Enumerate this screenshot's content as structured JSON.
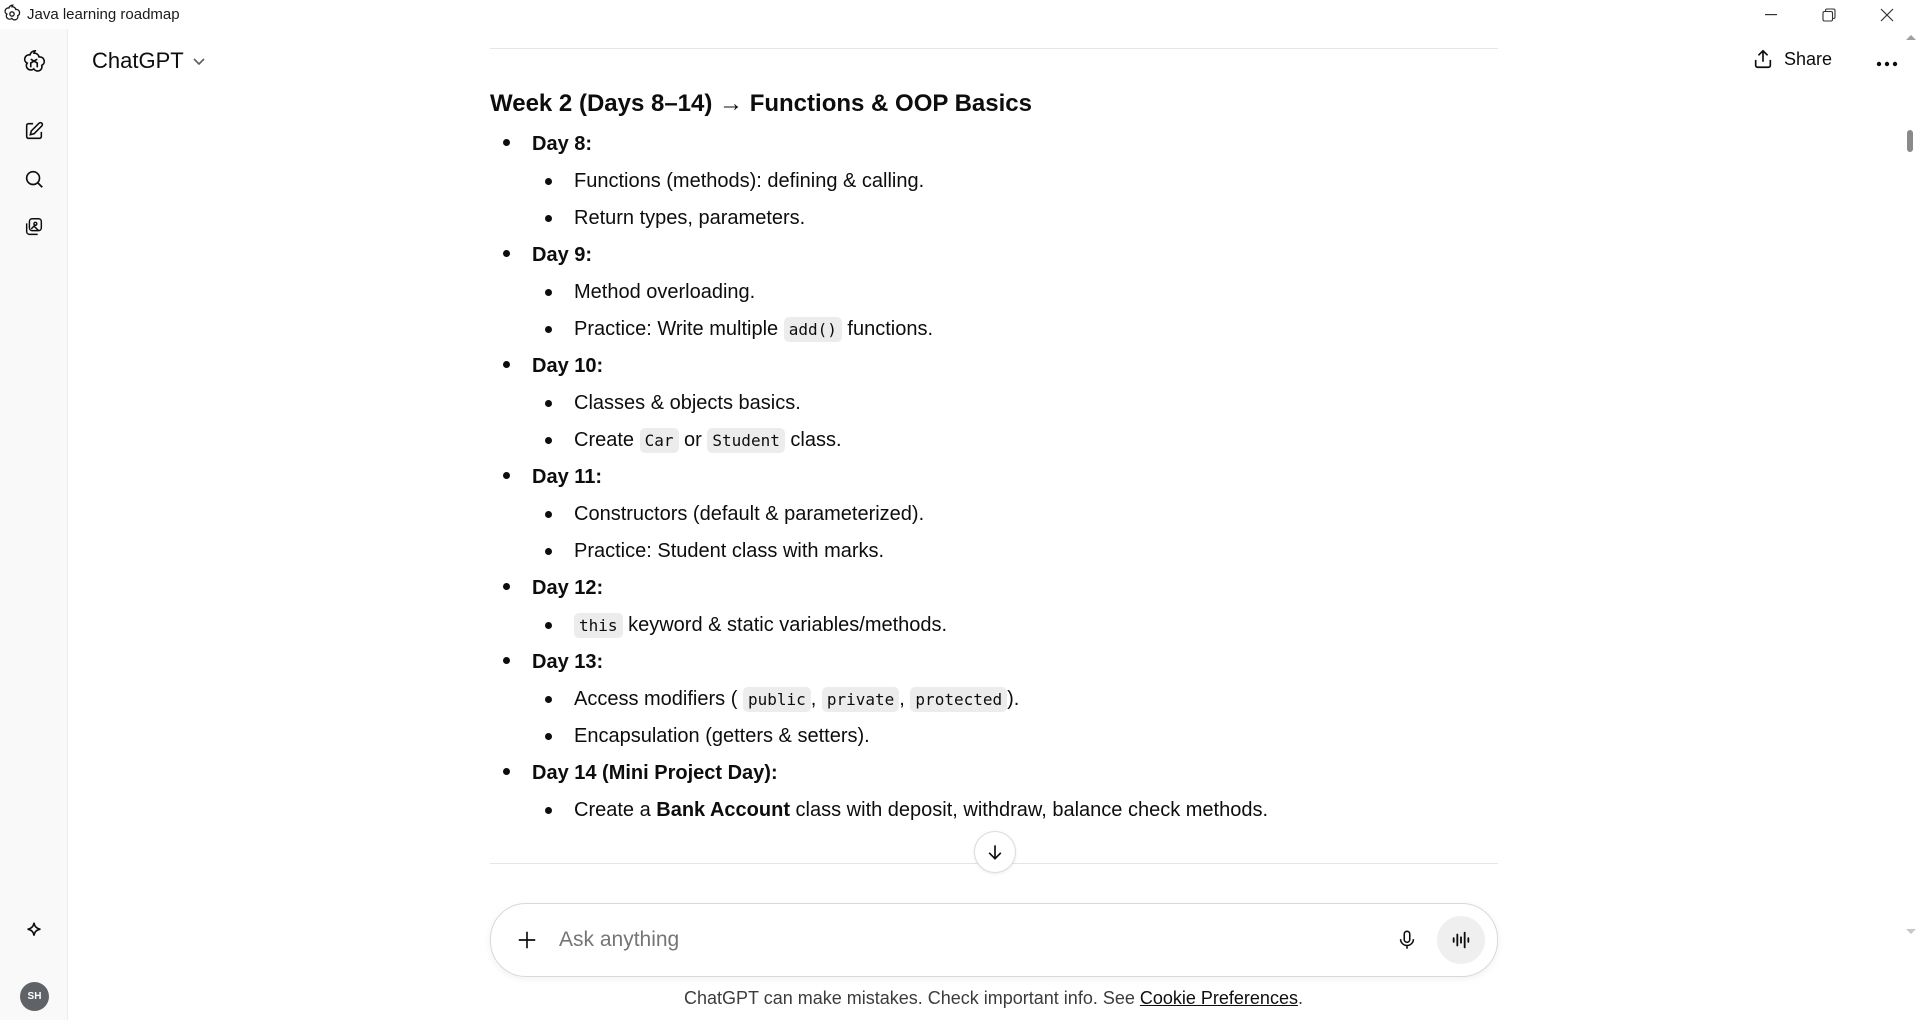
{
  "window": {
    "title": "Java learning roadmap"
  },
  "header": {
    "model_label": "ChatGPT",
    "share_label": "Share"
  },
  "sidebar": {
    "avatar_initials": "SH"
  },
  "content": {
    "week_heading": "Week 2 (Days 8–14) → Functions & OOP Basics",
    "days": [
      {
        "title": "Day 8:",
        "items": [
          [
            {
              "t": "Functions (methods): defining & calling."
            }
          ],
          [
            {
              "t": "Return types, parameters."
            }
          ]
        ]
      },
      {
        "title": "Day 9:",
        "items": [
          [
            {
              "t": "Method overloading."
            }
          ],
          [
            {
              "t": "Practice: Write multiple "
            },
            {
              "c": "add()"
            },
            {
              "t": " functions."
            }
          ]
        ]
      },
      {
        "title": "Day 10:",
        "items": [
          [
            {
              "t": "Classes & objects basics."
            }
          ],
          [
            {
              "t": "Create "
            },
            {
              "c": "Car"
            },
            {
              "t": " or "
            },
            {
              "c": "Student"
            },
            {
              "t": " class."
            }
          ]
        ]
      },
      {
        "title": "Day 11:",
        "items": [
          [
            {
              "t": "Constructors (default & parameterized)."
            }
          ],
          [
            {
              "t": "Practice: Student class with marks."
            }
          ]
        ]
      },
      {
        "title": "Day 12:",
        "items": [
          [
            {
              "c": "this"
            },
            {
              "t": " keyword & static variables/methods."
            }
          ]
        ]
      },
      {
        "title": "Day 13:",
        "items": [
          [
            {
              "t": "Access modifiers ( "
            },
            {
              "c": "public"
            },
            {
              "t": ", "
            },
            {
              "c": "private"
            },
            {
              "t": ", "
            },
            {
              "c": "protected"
            },
            {
              "t": ")."
            }
          ],
          [
            {
              "t": "Encapsulation (getters & setters)."
            }
          ]
        ]
      },
      {
        "title": "Day 14 (Mini Project Day):",
        "items": [
          [
            {
              "t": "Create a "
            },
            {
              "b": "Bank Account"
            },
            {
              "t": " class with deposit, withdraw, balance check methods."
            }
          ]
        ]
      }
    ]
  },
  "composer": {
    "placeholder": "Ask anything"
  },
  "footer": {
    "disclaimer_text": "ChatGPT can make mistakes. Check important info. See ",
    "link_text": "Cookie Preferences",
    "suffix": "."
  },
  "colors": {
    "text": "#0d0d0d",
    "code_bg": "#ececec",
    "sidebar_bg": "#f9f9f9"
  }
}
